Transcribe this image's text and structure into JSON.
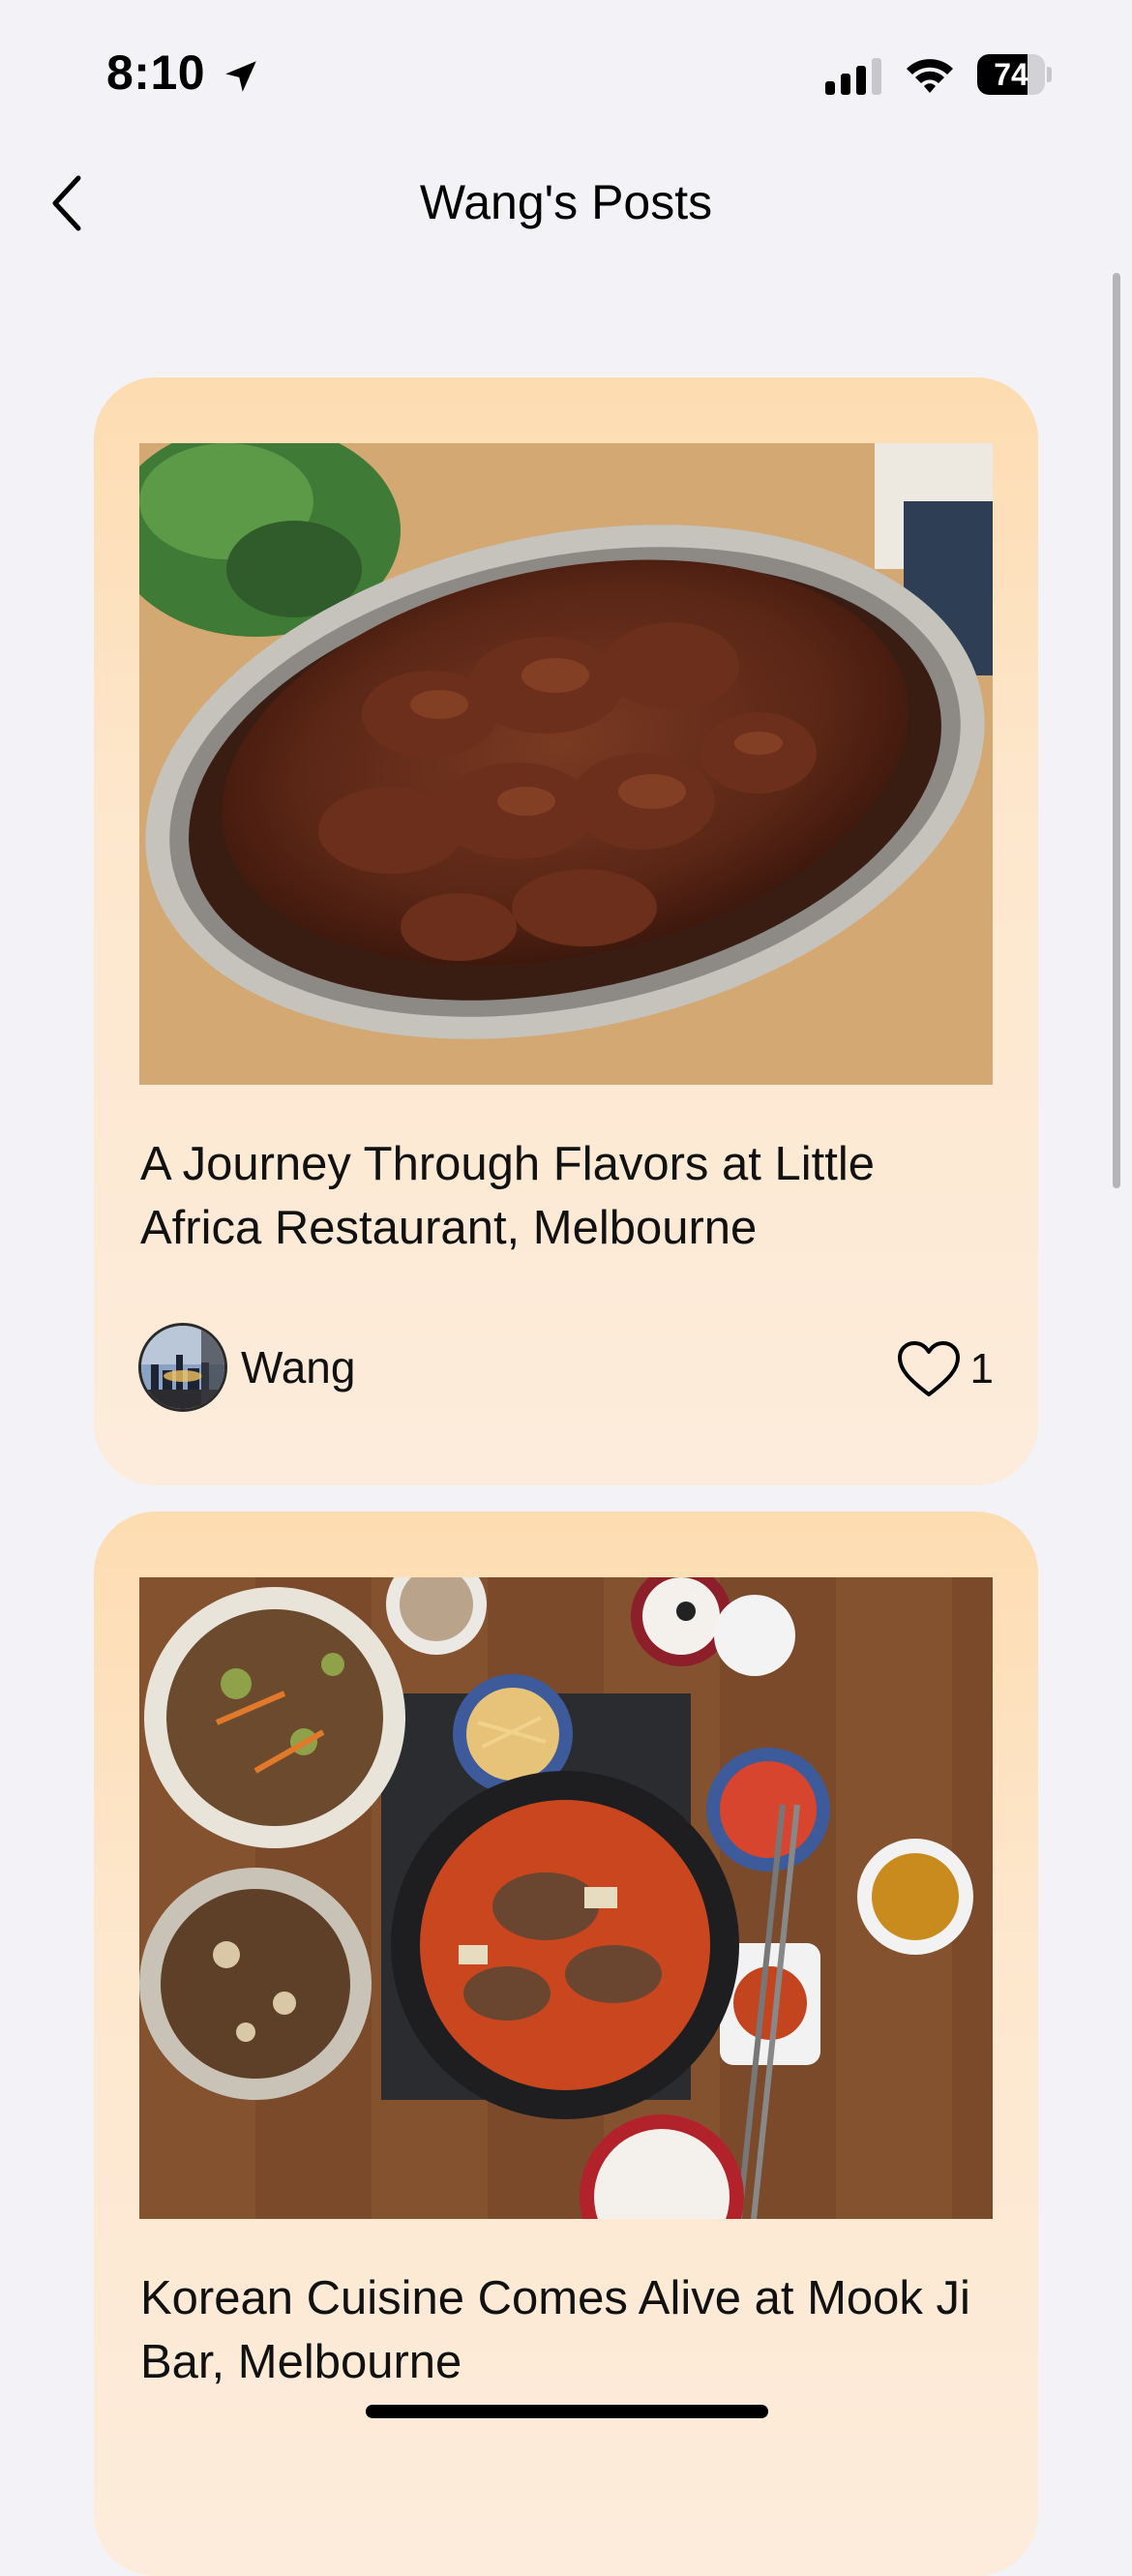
{
  "status_bar": {
    "time": "8:10",
    "battery_level": "74",
    "battery_fraction": 0.74,
    "icons": [
      "location-arrow-icon",
      "cellular-signal-icon",
      "wifi-icon",
      "battery-icon"
    ]
  },
  "nav": {
    "back_icon": "chevron-left-icon",
    "title": "Wang's Posts"
  },
  "posts": [
    {
      "photo": "braised-beef-platter-photo",
      "title": "A Journey Through Flavors at Little Africa Restaurant, Melbourne",
      "author": "Wang",
      "like_icon": "heart-outline-icon",
      "likes": "1"
    },
    {
      "photo": "korean-table-spread-photo",
      "title": "Korean Cuisine Comes Alive at Mook Ji Bar, Melbourne"
    }
  ],
  "colors": {
    "background": "#f2f2f7",
    "card_top": "#fddcb1",
    "card_bottom": "#fdecdc",
    "text": "#111111"
  }
}
